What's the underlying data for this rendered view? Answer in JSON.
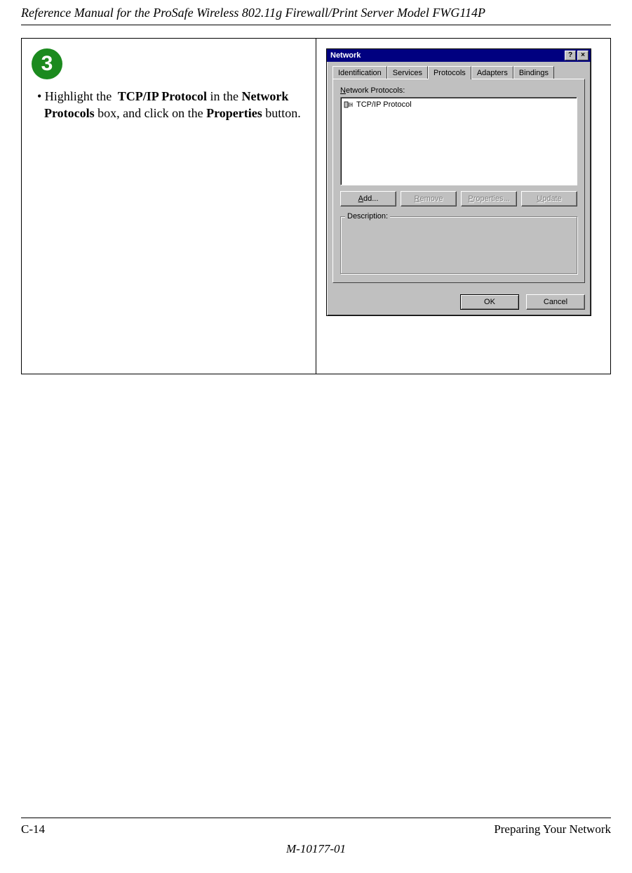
{
  "header": {
    "title": "Reference Manual for the ProSafe Wireless 802.11g  Firewall/Print Server Model FWG114P"
  },
  "step": {
    "number": "3",
    "instruction_prefix": "• Highlight the ",
    "bold1": "TCP/IP Protocol",
    "mid1": " in the ",
    "bold2": "Network Protocols",
    "mid2": " box, and click on the ",
    "bold3": "Properties",
    "suffix": " button."
  },
  "dialog": {
    "title": "Network",
    "help": "?",
    "close": "×",
    "tabs": {
      "identification": "Identification",
      "services": "Services",
      "protocols": "Protocols",
      "adapters": "Adapters",
      "bindings": "Bindings"
    },
    "protocols_label_pre": "N",
    "protocols_label_post": "etwork Protocols:",
    "list_item": "TCP/IP Protocol",
    "buttons": {
      "add_u": "A",
      "add": "dd...",
      "remove_u": "R",
      "remove": "emove",
      "properties_u": "P",
      "properties": "roperties...",
      "update_u": "U",
      "update": "pdate"
    },
    "description_label": "Description:",
    "ok": "OK",
    "cancel": "Cancel"
  },
  "footer": {
    "page": "C-14",
    "section": "Preparing Your Network",
    "docnum": "M-10177-01"
  }
}
